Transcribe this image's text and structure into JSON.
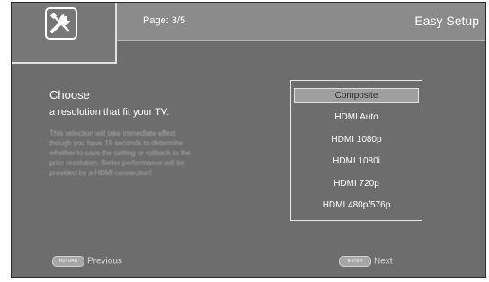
{
  "header": {
    "page_label": "Page: 3/5",
    "title": "Easy Setup",
    "icon": "wrench-screwdriver-icon"
  },
  "main": {
    "heading": "Choose",
    "subheading": "a resolution that fit your TV.",
    "description_lines": [
      "This selection will take immediate effect",
      "though you have 15 seconds to determine",
      "whether to save the setting or rollback to the",
      "prior resolution. Better performance will be",
      "provided by a HDMI connection!"
    ]
  },
  "options": {
    "items": [
      "Composite",
      "HDMI Auto",
      "HDMI 1080p",
      "HDMI 1080i",
      "HDMI 720p",
      "HDMI 480p/576p"
    ],
    "selected": "Composite"
  },
  "footer": {
    "prev_button": "Previous",
    "prev_key": "RETURN",
    "next_button": "Next",
    "next_key": "ENTER"
  },
  "colors": {
    "background": "#6d6d6d",
    "topbar": "#8b8b8b",
    "selected_option": "#9f9f9f"
  }
}
